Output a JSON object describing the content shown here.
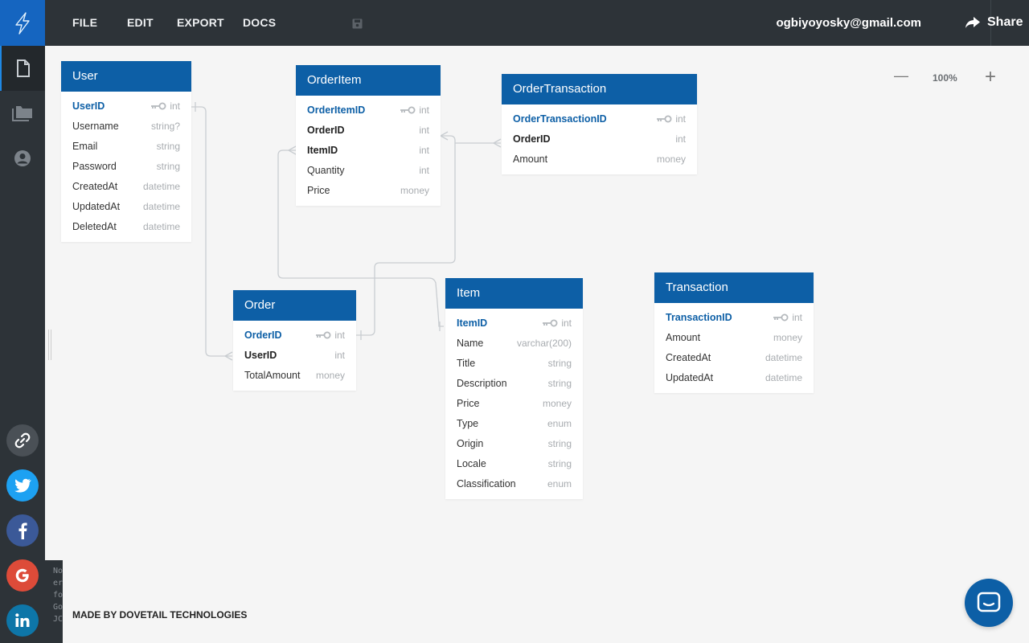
{
  "menu": {
    "file": "FILE",
    "edit": "EDIT",
    "export": "EXPORT",
    "docs": "DOCS"
  },
  "user": {
    "email": "ogbiyoyosky@gmail.com"
  },
  "share": {
    "label": "Share"
  },
  "zoom": {
    "minus": "—",
    "level": "100%",
    "plus": "+"
  },
  "footer": {
    "made_by": "MADE BY DOVETAIL TECHNOLOGIES"
  },
  "console": {
    "lines": [
      "No",
      "er",
      "fo",
      "Go",
      "JC"
    ]
  },
  "colors": {
    "brand": "#0d5fa6",
    "chrome": "#2d3338",
    "twitter": "#1da1f2",
    "facebook": "#3b5998",
    "google": "#dd4b39",
    "linkedin": "#0e76a8"
  },
  "tables": {
    "user": {
      "title": "User",
      "fields": [
        {
          "name": "UserID",
          "type": "int",
          "pk": true
        },
        {
          "name": "Username",
          "type": "string?"
        },
        {
          "name": "Email",
          "type": "string"
        },
        {
          "name": "Password",
          "type": "string"
        },
        {
          "name": "CreatedAt",
          "type": "datetime"
        },
        {
          "name": "UpdatedAt",
          "type": "datetime"
        },
        {
          "name": "DeletedAt",
          "type": "datetime"
        }
      ]
    },
    "orderitem": {
      "title": "OrderItem",
      "fields": [
        {
          "name": "OrderItemID",
          "type": "int",
          "pk": true
        },
        {
          "name": "OrderID",
          "type": "int",
          "fk": true
        },
        {
          "name": "ItemID",
          "type": "int",
          "fk": true
        },
        {
          "name": "Quantity",
          "type": "int"
        },
        {
          "name": "Price",
          "type": "money"
        }
      ]
    },
    "ordertransaction": {
      "title": "OrderTransaction",
      "fields": [
        {
          "name": "OrderTransactionID",
          "type": "int",
          "pk": true
        },
        {
          "name": "OrderID",
          "type": "int",
          "fk": true
        },
        {
          "name": "Amount",
          "type": "money"
        }
      ]
    },
    "order": {
      "title": "Order",
      "fields": [
        {
          "name": "OrderID",
          "type": "int",
          "pk": true
        },
        {
          "name": "UserID",
          "type": "int",
          "fk": true
        },
        {
          "name": "TotalAmount",
          "type": "money"
        }
      ]
    },
    "item": {
      "title": "Item",
      "fields": [
        {
          "name": "ItemID",
          "type": "int",
          "pk": true
        },
        {
          "name": "Name",
          "type": "varchar(200)"
        },
        {
          "name": "Title",
          "type": "string"
        },
        {
          "name": "Description",
          "type": "string"
        },
        {
          "name": "Price",
          "type": "money"
        },
        {
          "name": "Type",
          "type": "enum"
        },
        {
          "name": "Origin",
          "type": "string"
        },
        {
          "name": "Locale",
          "type": "string"
        },
        {
          "name": "Classification",
          "type": "enum"
        }
      ]
    },
    "transaction": {
      "title": "Transaction",
      "fields": [
        {
          "name": "TransactionID",
          "type": "int",
          "pk": true
        },
        {
          "name": "Amount",
          "type": "money"
        },
        {
          "name": "CreatedAt",
          "type": "datetime"
        },
        {
          "name": "UpdatedAt",
          "type": "datetime"
        }
      ]
    }
  }
}
